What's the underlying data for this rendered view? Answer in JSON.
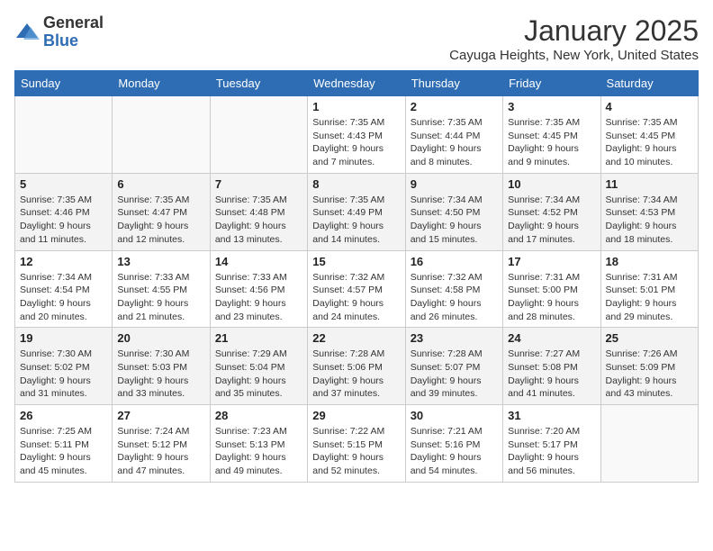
{
  "header": {
    "logo_general": "General",
    "logo_blue": "Blue",
    "month": "January 2025",
    "location": "Cayuga Heights, New York, United States"
  },
  "days_of_week": [
    "Sunday",
    "Monday",
    "Tuesday",
    "Wednesday",
    "Thursday",
    "Friday",
    "Saturday"
  ],
  "weeks": [
    [
      {
        "day": "",
        "info": ""
      },
      {
        "day": "",
        "info": ""
      },
      {
        "day": "",
        "info": ""
      },
      {
        "day": "1",
        "info": "Sunrise: 7:35 AM\nSunset: 4:43 PM\nDaylight: 9 hours and 7 minutes."
      },
      {
        "day": "2",
        "info": "Sunrise: 7:35 AM\nSunset: 4:44 PM\nDaylight: 9 hours and 8 minutes."
      },
      {
        "day": "3",
        "info": "Sunrise: 7:35 AM\nSunset: 4:45 PM\nDaylight: 9 hours and 9 minutes."
      },
      {
        "day": "4",
        "info": "Sunrise: 7:35 AM\nSunset: 4:45 PM\nDaylight: 9 hours and 10 minutes."
      }
    ],
    [
      {
        "day": "5",
        "info": "Sunrise: 7:35 AM\nSunset: 4:46 PM\nDaylight: 9 hours and 11 minutes."
      },
      {
        "day": "6",
        "info": "Sunrise: 7:35 AM\nSunset: 4:47 PM\nDaylight: 9 hours and 12 minutes."
      },
      {
        "day": "7",
        "info": "Sunrise: 7:35 AM\nSunset: 4:48 PM\nDaylight: 9 hours and 13 minutes."
      },
      {
        "day": "8",
        "info": "Sunrise: 7:35 AM\nSunset: 4:49 PM\nDaylight: 9 hours and 14 minutes."
      },
      {
        "day": "9",
        "info": "Sunrise: 7:34 AM\nSunset: 4:50 PM\nDaylight: 9 hours and 15 minutes."
      },
      {
        "day": "10",
        "info": "Sunrise: 7:34 AM\nSunset: 4:52 PM\nDaylight: 9 hours and 17 minutes."
      },
      {
        "day": "11",
        "info": "Sunrise: 7:34 AM\nSunset: 4:53 PM\nDaylight: 9 hours and 18 minutes."
      }
    ],
    [
      {
        "day": "12",
        "info": "Sunrise: 7:34 AM\nSunset: 4:54 PM\nDaylight: 9 hours and 20 minutes."
      },
      {
        "day": "13",
        "info": "Sunrise: 7:33 AM\nSunset: 4:55 PM\nDaylight: 9 hours and 21 minutes."
      },
      {
        "day": "14",
        "info": "Sunrise: 7:33 AM\nSunset: 4:56 PM\nDaylight: 9 hours and 23 minutes."
      },
      {
        "day": "15",
        "info": "Sunrise: 7:32 AM\nSunset: 4:57 PM\nDaylight: 9 hours and 24 minutes."
      },
      {
        "day": "16",
        "info": "Sunrise: 7:32 AM\nSunset: 4:58 PM\nDaylight: 9 hours and 26 minutes."
      },
      {
        "day": "17",
        "info": "Sunrise: 7:31 AM\nSunset: 5:00 PM\nDaylight: 9 hours and 28 minutes."
      },
      {
        "day": "18",
        "info": "Sunrise: 7:31 AM\nSunset: 5:01 PM\nDaylight: 9 hours and 29 minutes."
      }
    ],
    [
      {
        "day": "19",
        "info": "Sunrise: 7:30 AM\nSunset: 5:02 PM\nDaylight: 9 hours and 31 minutes."
      },
      {
        "day": "20",
        "info": "Sunrise: 7:30 AM\nSunset: 5:03 PM\nDaylight: 9 hours and 33 minutes."
      },
      {
        "day": "21",
        "info": "Sunrise: 7:29 AM\nSunset: 5:04 PM\nDaylight: 9 hours and 35 minutes."
      },
      {
        "day": "22",
        "info": "Sunrise: 7:28 AM\nSunset: 5:06 PM\nDaylight: 9 hours and 37 minutes."
      },
      {
        "day": "23",
        "info": "Sunrise: 7:28 AM\nSunset: 5:07 PM\nDaylight: 9 hours and 39 minutes."
      },
      {
        "day": "24",
        "info": "Sunrise: 7:27 AM\nSunset: 5:08 PM\nDaylight: 9 hours and 41 minutes."
      },
      {
        "day": "25",
        "info": "Sunrise: 7:26 AM\nSunset: 5:09 PM\nDaylight: 9 hours and 43 minutes."
      }
    ],
    [
      {
        "day": "26",
        "info": "Sunrise: 7:25 AM\nSunset: 5:11 PM\nDaylight: 9 hours and 45 minutes."
      },
      {
        "day": "27",
        "info": "Sunrise: 7:24 AM\nSunset: 5:12 PM\nDaylight: 9 hours and 47 minutes."
      },
      {
        "day": "28",
        "info": "Sunrise: 7:23 AM\nSunset: 5:13 PM\nDaylight: 9 hours and 49 minutes."
      },
      {
        "day": "29",
        "info": "Sunrise: 7:22 AM\nSunset: 5:15 PM\nDaylight: 9 hours and 52 minutes."
      },
      {
        "day": "30",
        "info": "Sunrise: 7:21 AM\nSunset: 5:16 PM\nDaylight: 9 hours and 54 minutes."
      },
      {
        "day": "31",
        "info": "Sunrise: 7:20 AM\nSunset: 5:17 PM\nDaylight: 9 hours and 56 minutes."
      },
      {
        "day": "",
        "info": ""
      }
    ]
  ]
}
